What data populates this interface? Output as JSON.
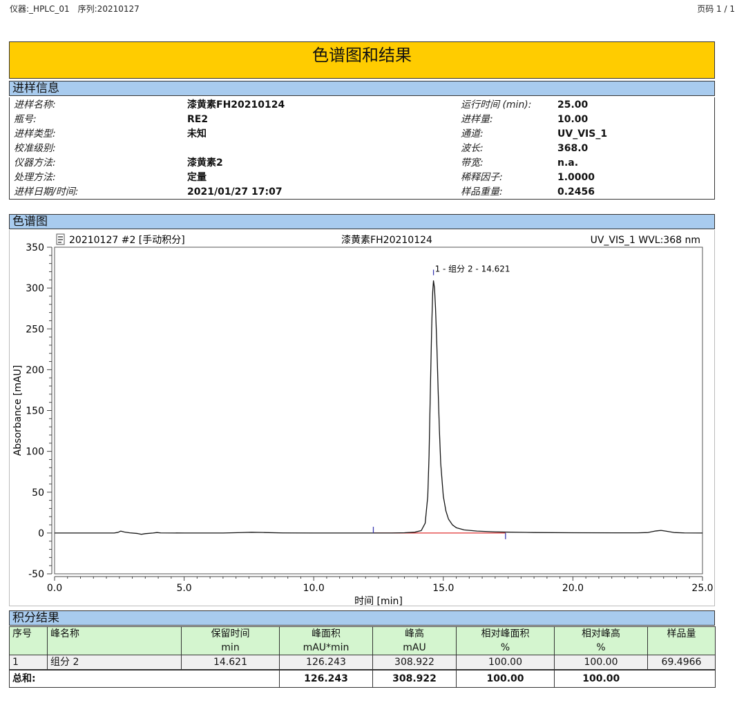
{
  "header": {
    "instrument": "仪器:_HPLC_01",
    "sequence": "序列:20210127",
    "page": "页码 1 / 1"
  },
  "title": "色谱图和结果",
  "injection_info": {
    "section_title": "进样信息",
    "left": [
      {
        "key": "进样名称:",
        "value": "漆黄素FH20210124"
      },
      {
        "key": "瓶号:",
        "value": "RE2"
      },
      {
        "key": "进样类型:",
        "value": "未知"
      },
      {
        "key": "校准级别:",
        "value": ""
      },
      {
        "key": "仪器方法:",
        "value": "漆黄素2"
      },
      {
        "key": "处理方法:",
        "value": "定量"
      },
      {
        "key": "进样日期/时间:",
        "value": "2021/01/27 17:07"
      }
    ],
    "right": [
      {
        "key": "运行时间 (min):",
        "value": "25.00"
      },
      {
        "key": "进样量:",
        "value": "10.00"
      },
      {
        "key": "通道:",
        "value": "UV_VIS_1"
      },
      {
        "key": "波长:",
        "value": "368.0"
      },
      {
        "key": "带宽:",
        "value": "n.a."
      },
      {
        "key": "稀释因子:",
        "value": "1.0000"
      },
      {
        "key": "样品重量:",
        "value": "0.2456"
      }
    ]
  },
  "chromatogram": {
    "section_title": "色谱图",
    "header_left": "20210127 #2 [手动积分]",
    "header_center": "漆黄素FH20210124",
    "header_right": "UV_VIS_1 WVL:368 nm"
  },
  "chart_data": {
    "type": "line",
    "xlabel": "时间 [min]",
    "ylabel": "Absorbance [mAU]",
    "xlim": [
      0,
      25
    ],
    "ylim": [
      -50,
      350
    ],
    "xticks": [
      0,
      5,
      10,
      15,
      20,
      25
    ],
    "xtick_labels": [
      "0.0",
      "5.0",
      "10.0",
      "15.0",
      "20.0",
      "25.0"
    ],
    "yticks": [
      -50,
      0,
      50,
      100,
      150,
      200,
      250,
      300,
      350
    ],
    "ytick_labels": [
      "-50",
      "0",
      "50",
      "100",
      "150",
      "200",
      "250",
      "300",
      "350"
    ],
    "grid": false,
    "series": [
      {
        "values": [
          [
            0,
            0
          ],
          [
            2.3,
            0
          ],
          [
            2.45,
            0.8
          ],
          [
            2.55,
            2.3
          ],
          [
            2.7,
            1.2
          ],
          [
            2.9,
            0.2
          ],
          [
            3.2,
            -0.6
          ],
          [
            3.35,
            -1.6
          ],
          [
            3.5,
            -0.8
          ],
          [
            3.8,
            0
          ],
          [
            3.95,
            0.6
          ],
          [
            4.1,
            0.1
          ],
          [
            5.0,
            0
          ],
          [
            6.5,
            0
          ],
          [
            7.2,
            0.5
          ],
          [
            7.6,
            0.9
          ],
          [
            8.1,
            0.6
          ],
          [
            8.8,
            0.1
          ],
          [
            10.0,
            0
          ],
          [
            12.0,
            0
          ],
          [
            13.0,
            0
          ],
          [
            13.5,
            0.3
          ],
          [
            13.9,
            1.0
          ],
          [
            14.15,
            3
          ],
          [
            14.3,
            12
          ],
          [
            14.4,
            45
          ],
          [
            14.45,
            95
          ],
          [
            14.5,
            175
          ],
          [
            14.55,
            250
          ],
          [
            14.59,
            295
          ],
          [
            14.621,
            308.9
          ],
          [
            14.66,
            300
          ],
          [
            14.7,
            275
          ],
          [
            14.75,
            230
          ],
          [
            14.8,
            175
          ],
          [
            14.85,
            125
          ],
          [
            14.9,
            85
          ],
          [
            15.0,
            45
          ],
          [
            15.1,
            27
          ],
          [
            15.2,
            17
          ],
          [
            15.35,
            10
          ],
          [
            15.5,
            6.5
          ],
          [
            15.8,
            3.8
          ],
          [
            16.3,
            2.3
          ],
          [
            17.0,
            1.4
          ],
          [
            17.4,
            1.1
          ],
          [
            18.5,
            0.6
          ],
          [
            20.0,
            0.3
          ],
          [
            22.5,
            0.2
          ],
          [
            22.9,
            0.6
          ],
          [
            23.2,
            2.5
          ],
          [
            23.4,
            3.2
          ],
          [
            23.6,
            2.2
          ],
          [
            23.9,
            0.6
          ],
          [
            24.3,
            0.1
          ],
          [
            25.0,
            0
          ]
        ]
      }
    ],
    "baseline": {
      "start": [
        12.3,
        0
      ],
      "end": [
        17.4,
        0
      ]
    },
    "markers": [
      {
        "x": 12.3,
        "y": 0
      },
      {
        "x": 14.621,
        "y": 308.922
      },
      {
        "x": 17.4,
        "y": 0
      }
    ],
    "peak_annotation": {
      "x": 14.621,
      "y": 308.922,
      "text": "1 - 组分 2 - 14.621"
    },
    "colors": {
      "trace": "#111111",
      "baseline": "#e03030",
      "marker": "#3a3ab0"
    }
  },
  "results": {
    "section_title": "积分结果",
    "columns": [
      {
        "line1": "序号",
        "line2": ""
      },
      {
        "line1": "峰名称",
        "line2": ""
      },
      {
        "line1": "保留时间",
        "line2": "min"
      },
      {
        "line1": "峰面积",
        "line2": "mAU*min"
      },
      {
        "line1": "峰高",
        "line2": "mAU"
      },
      {
        "line1": "相对峰面积",
        "line2": "%"
      },
      {
        "line1": "相对峰高",
        "line2": "%"
      },
      {
        "line1": "样品量",
        "line2": ""
      }
    ],
    "rows": [
      [
        "1",
        "组分 2",
        "14.621",
        "126.243",
        "308.922",
        "100.00",
        "100.00",
        "69.4966"
      ]
    ],
    "total": [
      "总和:",
      "",
      "",
      "126.243",
      "308.922",
      "100.00",
      "100.00",
      ""
    ]
  }
}
